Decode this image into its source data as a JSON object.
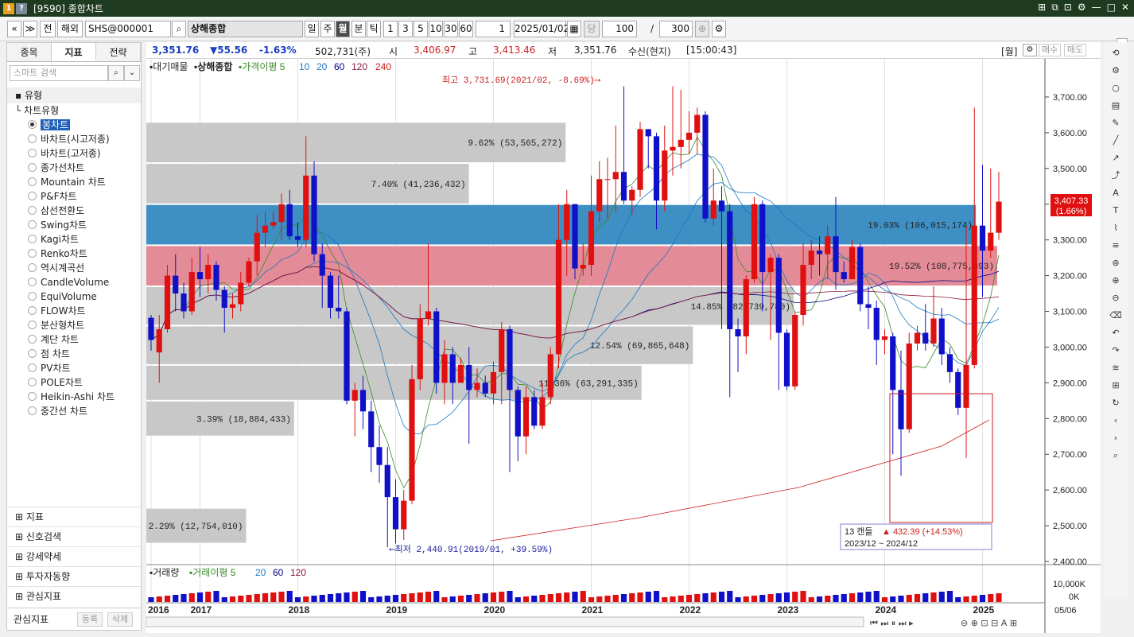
{
  "window": {
    "title": "[9590] 종합차트",
    "icons": [
      "1",
      "?"
    ],
    "controls": [
      "⊞",
      "⧉",
      "⊡",
      "⚙",
      "—",
      "□",
      "✕"
    ]
  },
  "toolbar": {
    "nav_prev": "«",
    "nav_menu": "≫",
    "all_label": "전",
    "overseas_label": "해외",
    "symbol_code": "SHS@000001",
    "symbol_name": "상해종합",
    "periods": [
      "일",
      "주",
      "월",
      "분",
      "틱"
    ],
    "active_period": "월",
    "intervals": [
      "1",
      "3",
      "5",
      "10",
      "30",
      "60"
    ],
    "interval_value": "1",
    "date": "2025/01/02",
    "date_suffix": "당",
    "count": "100",
    "slash": "/",
    "total": "300",
    "icons": [
      "search-icon",
      "calendar-icon",
      "zoom-icon",
      "settings-icon"
    ]
  },
  "left_panel": {
    "tabs": [
      "종목",
      "지표",
      "전략"
    ],
    "active_tab": "지표",
    "search_placeholder": "스마트 검색",
    "section": "유형",
    "subsection": "차트유형",
    "chart_types": [
      "봉차트",
      "바차트(시고저종)",
      "바차트(고저종)",
      "종가선차트",
      "Mountain 차트",
      "P&F차트",
      "삼선전환도",
      "Swing차트",
      "Kagi차트",
      "Renko차트",
      "역시계곡선",
      "CandleVolume",
      "EquiVolume",
      "FLOW차트",
      "분산형차트",
      "계단 차트",
      "점 차트",
      "PV차트",
      "POLE차트",
      "Heikin-Ashi 차트",
      "중간선 차트"
    ],
    "selected_type": "봉차트",
    "groups": [
      "지표",
      "신호검색",
      "강세약세",
      "투자자동향",
      "관심지표"
    ],
    "bottom_label": "관심지표",
    "bottom_buttons": [
      "등록",
      "삭제"
    ]
  },
  "info_bar": {
    "price": "3,351.76",
    "change": "▼55.56",
    "change_pct": "-1.63%",
    "volume": "502,731(주)",
    "open_label": "시",
    "open": "3,406.97",
    "high_label": "고",
    "high": "3,413.46",
    "low_label": "저",
    "low": "3,351.76",
    "source": "수신(현지)",
    "time": "[15:00:43]",
    "right_items": [
      "[월]",
      "매수",
      "매도"
    ]
  },
  "chart_data": {
    "type": "candlestick",
    "legend_main": [
      "대기매물",
      "상해종합",
      "가격이평 5",
      "10",
      "20",
      "60",
      "120",
      "240"
    ],
    "legend_colors": {
      "가격이평 5": "#3a8a2a",
      "10": "#1a78c2",
      "20": "#1a78c2",
      "60": "#000080",
      "120": "#8b1a3a",
      "240": "#cc1e1e"
    },
    "y_ticks": [
      2400,
      2500,
      2600,
      2700,
      2800,
      2900,
      3000,
      3100,
      3200,
      3300,
      3400,
      3500,
      3600,
      3700
    ],
    "y_tick_labels": [
      "2,400.00",
      "2,500.00",
      "2,600.00",
      "2,700.00",
      "2,800.00",
      "2,900.00",
      "3,000.00",
      "3,100.00",
      "3,200.00",
      "3,300.00",
      "3,400.00",
      "3,500.00",
      "3,600.00",
      "3,700.00"
    ],
    "x_labels": [
      "2016",
      "2017",
      "2018",
      "2019",
      "2020",
      "2021",
      "2022",
      "2023",
      "2024",
      "2025"
    ],
    "x_right_label": "05/06",
    "candles": [
      [
        3082,
        3020,
        2990,
        3090
      ],
      [
        2985,
        3050,
        2900,
        3090
      ],
      [
        3050,
        3200,
        3040,
        3230
      ],
      [
        3200,
        3150,
        3100,
        3260
      ],
      [
        3150,
        3100,
        3080,
        3180
      ],
      [
        3100,
        3210,
        3090,
        3250
      ],
      [
        3210,
        3190,
        3140,
        3280
      ],
      [
        3190,
        3230,
        3150,
        3260
      ],
      [
        3230,
        3160,
        3130,
        3240
      ],
      [
        3160,
        3110,
        3040,
        3170
      ],
      [
        3110,
        3120,
        3080,
        3150
      ],
      [
        3120,
        3180,
        3100,
        3210
      ],
      [
        3180,
        3240,
        3170,
        3250
      ],
      [
        3240,
        3320,
        3200,
        3370
      ],
      [
        3320,
        3340,
        3280,
        3380
      ],
      [
        3340,
        3350,
        3330,
        3380
      ],
      [
        3350,
        3400,
        3300,
        3430
      ],
      [
        3400,
        3310,
        3300,
        3440
      ],
      [
        3310,
        3300,
        3280,
        3350
      ],
      [
        3300,
        3480,
        3280,
        3590
      ],
      [
        3480,
        3260,
        3240,
        3520
      ],
      [
        3260,
        3200,
        3110,
        3290
      ],
      [
        3200,
        3110,
        3080,
        3210
      ],
      [
        3110,
        3100,
        3080,
        3200
      ],
      [
        3100,
        2850,
        2840,
        3110
      ],
      [
        2850,
        2880,
        2750,
        2900
      ],
      [
        2880,
        2820,
        2770,
        2920
      ],
      [
        2820,
        2720,
        2650,
        2850
      ],
      [
        2720,
        2670,
        2620,
        2780
      ],
      [
        2670,
        2580,
        2440,
        2720
      ],
      [
        2580,
        2490,
        2450,
        2630
      ],
      [
        2490,
        2570,
        2460,
        2600
      ],
      [
        2570,
        2910,
        2560,
        2950
      ],
      [
        2910,
        3080,
        2880,
        3120
      ],
      [
        3080,
        3100,
        3060,
        3290
      ],
      [
        3100,
        2900,
        2870,
        3110
      ],
      [
        2900,
        2980,
        2840,
        3020
      ],
      [
        2980,
        2900,
        2840,
        3000
      ],
      [
        2900,
        2950,
        2900,
        2970
      ],
      [
        2950,
        2880,
        2730,
        3000
      ],
      [
        2880,
        2900,
        2860,
        2940
      ],
      [
        2900,
        2870,
        2860,
        2920
      ],
      [
        2870,
        2930,
        2840,
        2960
      ],
      [
        2930,
        3050,
        2840,
        3070
      ],
      [
        3050,
        2880,
        2650,
        3060
      ],
      [
        2880,
        2750,
        2680,
        2890
      ],
      [
        2750,
        2860,
        2700,
        2890
      ],
      [
        2860,
        2780,
        2770,
        2880
      ],
      [
        2780,
        2860,
        2770,
        2900
      ],
      [
        2860,
        2980,
        2840,
        3000
      ],
      [
        2980,
        3300,
        2940,
        3400
      ],
      [
        3300,
        3400,
        3200,
        3440
      ],
      [
        3400,
        3220,
        3190,
        3400
      ],
      [
        3220,
        3230,
        3200,
        3290
      ],
      [
        3230,
        3380,
        3200,
        3480
      ],
      [
        3380,
        3470,
        3350,
        3520
      ],
      [
        3470,
        3470,
        3360,
        3530
      ],
      [
        3470,
        3490,
        3380,
        3620
      ],
      [
        3490,
        3410,
        3400,
        3730
      ],
      [
        3410,
        3440,
        3370,
        3450
      ],
      [
        3440,
        3610,
        3420,
        3630
      ],
      [
        3610,
        3590,
        3500,
        3610
      ],
      [
        3590,
        3410,
        3330,
        3600
      ],
      [
        3410,
        3550,
        3380,
        3620
      ],
      [
        3550,
        3560,
        3480,
        3730
      ],
      [
        3560,
        3580,
        3500,
        3720
      ],
      [
        3580,
        3600,
        3540,
        3660
      ],
      [
        3600,
        3650,
        3540,
        3670
      ],
      [
        3650,
        3360,
        3350,
        3660
      ],
      [
        3360,
        3410,
        3340,
        3500
      ],
      [
        3410,
        3380,
        3050,
        3450
      ],
      [
        3380,
        3050,
        2860,
        3400
      ],
      [
        3050,
        3030,
        2930,
        3080
      ],
      [
        3030,
        3190,
        2980,
        3200
      ],
      [
        3190,
        3400,
        3180,
        3420
      ],
      [
        3400,
        3210,
        3100,
        3410
      ],
      [
        3210,
        3250,
        3020,
        3260
      ],
      [
        3250,
        3040,
        2880,
        3260
      ],
      [
        3040,
        2890,
        2880,
        3050
      ],
      [
        2890,
        3090,
        2880,
        3100
      ],
      [
        3090,
        3230,
        3060,
        3290
      ],
      [
        3230,
        3270,
        3190,
        3300
      ],
      [
        3270,
        3260,
        3200,
        3310
      ],
      [
        3260,
        3310,
        3190,
        3340
      ],
      [
        3310,
        3210,
        3160,
        3420
      ],
      [
        3210,
        3190,
        3180,
        3240
      ],
      [
        3190,
        3280,
        3190,
        3300
      ],
      [
        3280,
        3120,
        3100,
        3290
      ],
      [
        3120,
        3110,
        3050,
        3170
      ],
      [
        3110,
        3020,
        2950,
        3130
      ],
      [
        3020,
        3030,
        2980,
        3050
      ],
      [
        3030,
        2880,
        2700,
        3040
      ],
      [
        2880,
        2770,
        2640,
        2990
      ],
      [
        2770,
        3010,
        2760,
        3040
      ],
      [
        3010,
        3040,
        2990,
        3060
      ],
      [
        3040,
        3010,
        2990,
        3120
      ],
      [
        3010,
        3080,
        3000,
        3170
      ],
      [
        3080,
        2980,
        2950,
        3110
      ],
      [
        2980,
        2930,
        2900,
        3000
      ],
      [
        2930,
        2830,
        2810,
        2940
      ],
      [
        2830,
        2950,
        2690,
        3340
      ],
      [
        2950,
        3340,
        2940,
        3670
      ],
      [
        3340,
        3270,
        3140,
        3510
      ],
      [
        3270,
        3320,
        3250,
        3500
      ],
      [
        3320,
        3407,
        3300,
        3490
      ]
    ],
    "ma_labels": [
      "MA5",
      "MA10",
      "MA20",
      "MA60",
      "MA120",
      "MA240"
    ],
    "volume_profile": [
      {
        "pct": "2.29%",
        "volume": "12,754,010",
        "range": [
          2450,
          2550
        ]
      },
      {
        "pct": "3.39%",
        "volume": "18,884,433",
        "range": [
          2750,
          2850
        ]
      },
      {
        "pct": "11.36%",
        "volume": "63,291,335",
        "range": [
          2850,
          2950
        ]
      },
      {
        "pct": "12.54%",
        "volume": "69,865,648",
        "range": [
          2950,
          3060
        ]
      },
      {
        "pct": "14.85%",
        "volume": "82,739,780",
        "range": [
          3060,
          3170
        ]
      },
      {
        "pct": "19.52%",
        "volume": "108,775,893",
        "range": [
          3170,
          3285
        ]
      },
      {
        "pct": "19.03%",
        "volume": "106,015,174",
        "range": [
          3285,
          3400
        ]
      },
      {
        "pct": "7.40%",
        "volume": "41,236,432",
        "range": [
          3400,
          3515
        ]
      },
      {
        "pct": "9.62%",
        "volume": "53,565,272",
        "range": [
          3515,
          3630
        ]
      }
    ],
    "annotation_high": "최고 3,731.69(2021/02, -8.69%)",
    "annotation_low": "최저 2,440.91(2019/01, +39.59%)",
    "current_price_label": "3,407.33",
    "current_pct_label": "(1.66%)",
    "range_box": {
      "count": "13 캔들",
      "change": "▲ 432.39 (+14.53%)",
      "period": "2023/12 ~ 2024/12"
    },
    "volume_legend": [
      "거래량",
      "거래이평 5",
      "20",
      "60",
      "120"
    ],
    "volume_ticks": [
      "10,000K",
      "0K"
    ]
  },
  "right_toolbar": [
    "refresh-icon",
    "gear-icon",
    "circle-icon",
    "chart-icon",
    "pencil-icon",
    "line-icon",
    "arrow-icon",
    "trend-icon",
    "auto-icon",
    "text-icon",
    "pattern-icon",
    "fib-icon",
    "magnet-icon",
    "zoomin-icon",
    "zoomout-icon",
    "erase-icon",
    "undo-icon",
    "redo-icon",
    "gann-icon",
    "grid-icon",
    "cycle-icon",
    "back-icon",
    "fwd-icon",
    "search-icon"
  ]
}
